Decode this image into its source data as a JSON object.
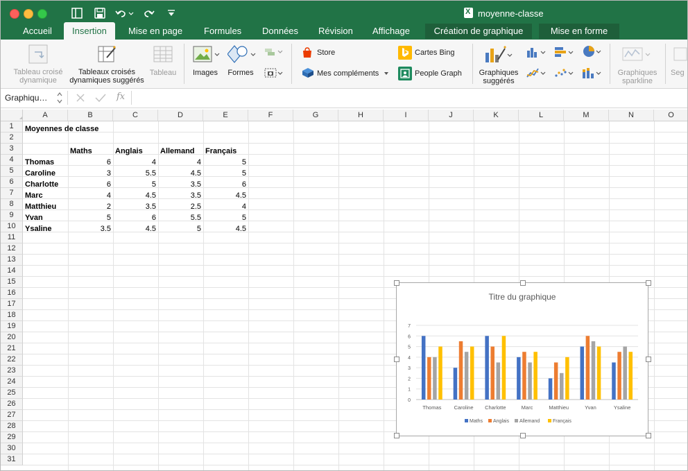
{
  "window": {
    "file_name": "moyenne-classe"
  },
  "tabs": [
    {
      "label": "Accueil"
    },
    {
      "label": "Insertion"
    },
    {
      "label": "Mise en page"
    },
    {
      "label": "Formules"
    },
    {
      "label": "Données"
    },
    {
      "label": "Révision"
    },
    {
      "label": "Affichage"
    },
    {
      "label": "Création de graphique"
    },
    {
      "label": "Mise en forme"
    }
  ],
  "ribbon": {
    "tableau_croise_l1": "Tableau croisé",
    "tableau_croise_l2": "dynamique",
    "tableaux_suggeres_l1": "Tableaux croisés",
    "tableaux_suggeres_l2": "dynamiques suggérés",
    "tableau": "Tableau",
    "images": "Images",
    "formes": "Formes",
    "store": "Store",
    "complements": "Mes compléments",
    "cartes_bing": "Cartes Bing",
    "people_graph": "People Graph",
    "graphiques_l1": "Graphiques",
    "graphiques_l2": "suggérés",
    "sparkline_l1": "Graphiques",
    "sparkline_l2": "sparkline",
    "segment": "Seg"
  },
  "formula_bar": {
    "name_box": "Graphiqu…",
    "fx": "fx"
  },
  "columns": [
    "A",
    "B",
    "C",
    "D",
    "E",
    "F",
    "G",
    "H",
    "I",
    "J",
    "K",
    "L",
    "M",
    "N",
    "O"
  ],
  "rows": [
    "1",
    "2",
    "3",
    "4",
    "5",
    "6",
    "7",
    "8",
    "9",
    "10",
    "11",
    "12",
    "13",
    "14",
    "15",
    "16",
    "17",
    "18",
    "19",
    "20",
    "21",
    "22",
    "23",
    "24",
    "25",
    "26",
    "27",
    "28",
    "29",
    "30",
    "31"
  ],
  "sheet": {
    "title": "Moyennes de classe",
    "headers": [
      "Maths",
      "Anglais",
      "Allemand",
      "Français"
    ],
    "students": [
      {
        "name": "Thomas",
        "values": [
          "6",
          "4",
          "4",
          "5"
        ]
      },
      {
        "name": "Caroline",
        "values": [
          "3",
          "5.5",
          "4.5",
          "5"
        ]
      },
      {
        "name": "Charlotte",
        "values": [
          "6",
          "5",
          "3.5",
          "6"
        ]
      },
      {
        "name": "Marc",
        "values": [
          "4",
          "4.5",
          "3.5",
          "4.5"
        ]
      },
      {
        "name": "Matthieu",
        "values": [
          "2",
          "3.5",
          "2.5",
          "4"
        ]
      },
      {
        "name": "Yvan",
        "values": [
          "5",
          "6",
          "5.5",
          "5"
        ]
      },
      {
        "name": "Ysaline",
        "values": [
          "3.5",
          "4.5",
          "5",
          "4.5"
        ]
      }
    ]
  },
  "chart_data": {
    "type": "bar",
    "title": "Titre du graphique",
    "categories": [
      "Thomas",
      "Caroline",
      "Charlotte",
      "Marc",
      "Matthieu",
      "Yvan",
      "Ysaline"
    ],
    "series": [
      {
        "name": "Maths",
        "color": "#4472c4",
        "values": [
          6,
          3,
          6,
          4,
          2,
          5,
          3.5
        ]
      },
      {
        "name": "Anglais",
        "color": "#ed7d31",
        "values": [
          4,
          5.5,
          5,
          4.5,
          3.5,
          6,
          4.5
        ]
      },
      {
        "name": "Allemand",
        "color": "#a5a5a5",
        "values": [
          4,
          4.5,
          3.5,
          3.5,
          2.5,
          5.5,
          5
        ]
      },
      {
        "name": "Français",
        "color": "#ffc000",
        "values": [
          5,
          5,
          6,
          4.5,
          4,
          5,
          4.5
        ]
      }
    ],
    "ylim": [
      0,
      7
    ],
    "yticks": [
      "0",
      "1",
      "2",
      "3",
      "4",
      "5",
      "6",
      "7"
    ],
    "grid": true,
    "legend": "bottom"
  }
}
